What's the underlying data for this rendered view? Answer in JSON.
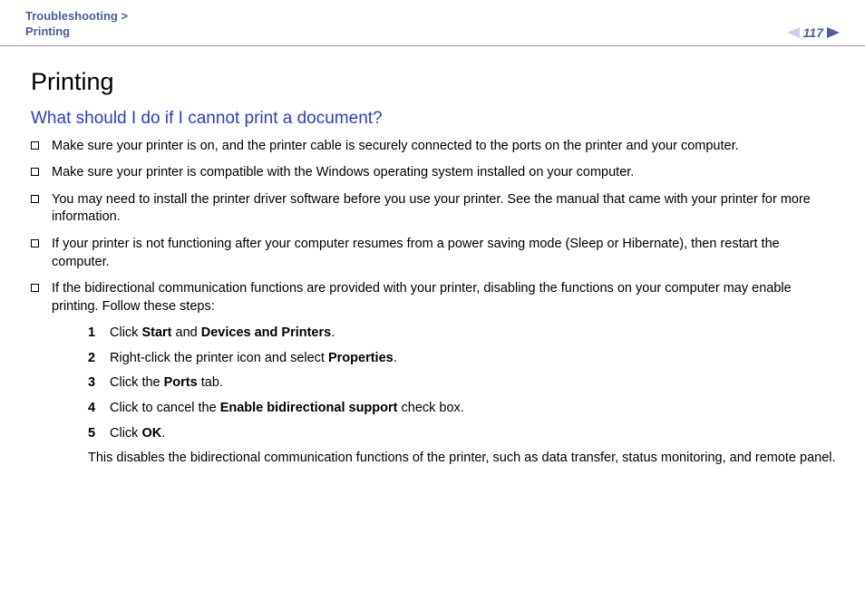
{
  "header": {
    "breadcrumb_line1": "Troubleshooting >",
    "breadcrumb_line2": "Printing",
    "page_number": "117"
  },
  "body": {
    "title": "Printing",
    "subtitle": "What should I do if I cannot print a document?",
    "bullets": [
      {
        "text": "Make sure your printer is on, and the printer cable is securely connected to the ports on the printer and your computer."
      },
      {
        "text": "Make sure your printer is compatible with the Windows operating system installed on your computer."
      },
      {
        "text": "You may need to install the printer driver software before you use your printer. See the manual that came with your printer for more information."
      },
      {
        "text": "If your printer is not functioning after your computer resumes from a power saving mode (Sleep or Hibernate), then restart the computer."
      },
      {
        "text": "If the bidirectional communication functions are provided with your printer, disabling the functions on your computer may enable printing. Follow these steps:",
        "has_steps": true
      }
    ],
    "steps": [
      {
        "n": "1",
        "prefix": "Click ",
        "bold1": "Start",
        "mid": " and ",
        "bold2": "Devices and Printers",
        "suffix": "."
      },
      {
        "n": "2",
        "prefix": "Right-click the printer icon and select ",
        "bold1": "Properties",
        "mid": "",
        "bold2": "",
        "suffix": "."
      },
      {
        "n": "3",
        "prefix": "Click the ",
        "bold1": "Ports",
        "mid": "",
        "bold2": "",
        "suffix": " tab."
      },
      {
        "n": "4",
        "prefix": "Click to cancel the ",
        "bold1": "Enable bidirectional support",
        "mid": "",
        "bold2": "",
        "suffix": " check box."
      },
      {
        "n": "5",
        "prefix": "Click ",
        "bold1": "OK",
        "mid": "",
        "bold2": "",
        "suffix": "."
      }
    ],
    "after_steps": "This disables the bidirectional communication functions of the printer, such as data transfer, status monitoring, and remote panel."
  }
}
